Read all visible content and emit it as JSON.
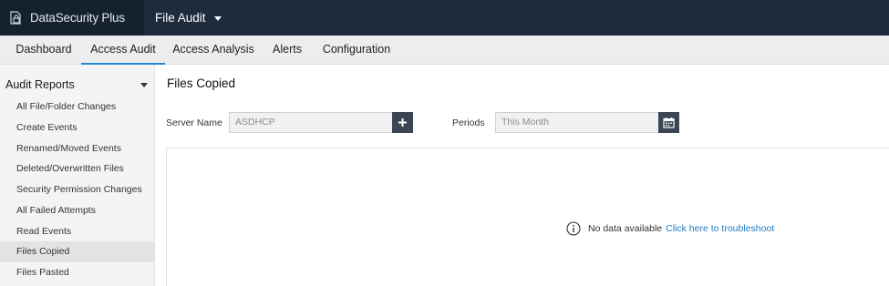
{
  "app": {
    "brand": "DataSecurity Plus",
    "brand_icon": "lock-file-icon",
    "module": "File Audit"
  },
  "tabs": [
    {
      "label": "Dashboard",
      "active": false
    },
    {
      "label": "Access Audit",
      "active": true
    },
    {
      "label": "Access Analysis",
      "active": false
    },
    {
      "label": "Alerts",
      "active": false
    },
    {
      "label": "Configuration",
      "active": false
    }
  ],
  "sidebar": {
    "header": "Audit Reports",
    "items": [
      {
        "label": "All File/Folder Changes"
      },
      {
        "label": "Create Events"
      },
      {
        "label": "Renamed/Moved Events"
      },
      {
        "label": "Deleted/Overwritten Files"
      },
      {
        "label": "Security Permission Changes"
      },
      {
        "label": "All Failed Attempts"
      },
      {
        "label": "Read Events"
      },
      {
        "label": "Files Copied",
        "selected": true
      },
      {
        "label": "Files Pasted"
      }
    ]
  },
  "main": {
    "title": "Files Copied",
    "server_label": "Server Name",
    "server_value": "ASDHCP",
    "periods_label": "Periods",
    "periods_value": "This Month",
    "nodata_text": "No data available",
    "nodata_link": "Click here to troubleshoot"
  },
  "colors": {
    "topbar": "#1e2b3c",
    "accent": "#1f8ad8",
    "link": "#1f7bc4",
    "button": "#3b4655"
  }
}
